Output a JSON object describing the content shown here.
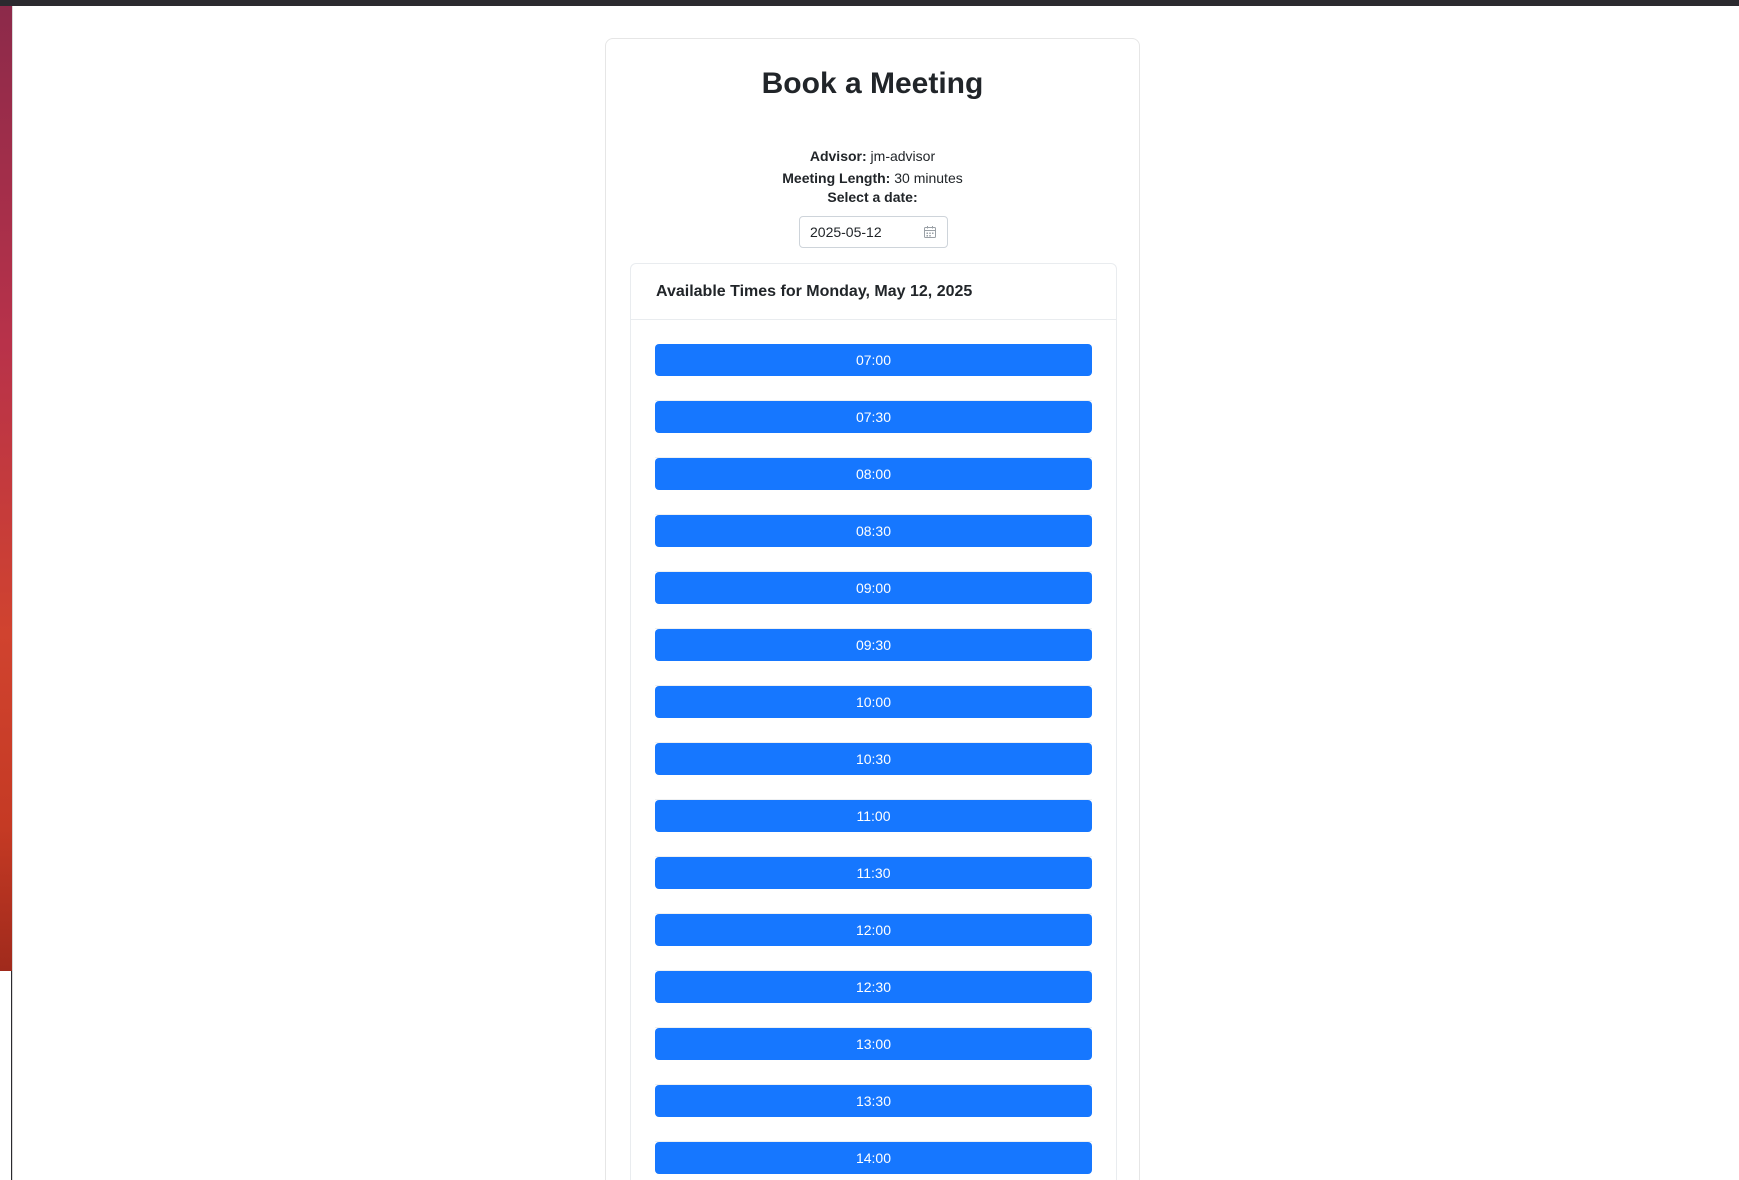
{
  "page": {
    "title": "Book a Meeting",
    "advisor_label": "Advisor:",
    "advisor_value": "jm-advisor",
    "length_label": "Meeting Length:",
    "length_value": "30 minutes"
  },
  "date_picker": {
    "label": "Select a date:",
    "value": "2025-05-12",
    "icon": "calendar-icon"
  },
  "slots": {
    "heading": "Available Times for Monday, May 12, 2025",
    "times": [
      "07:00",
      "07:30",
      "08:00",
      "08:30",
      "09:00",
      "09:30",
      "10:00",
      "10:30",
      "11:00",
      "11:30",
      "12:00",
      "12:30",
      "13:00",
      "13:30",
      "14:00"
    ]
  },
  "colors": {
    "slot_button": "#1677ff",
    "slot_text": "#ffffff"
  }
}
